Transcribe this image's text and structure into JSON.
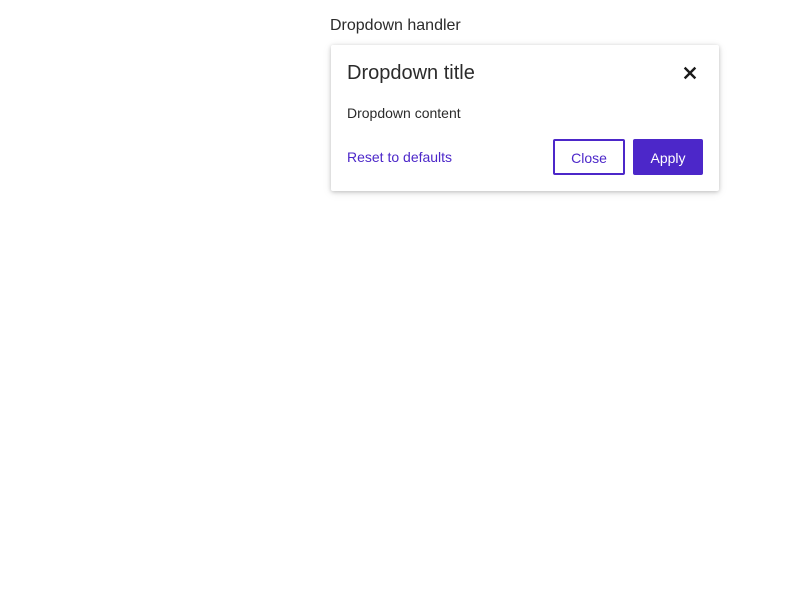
{
  "handler": {
    "label": "Dropdown handler"
  },
  "dropdown": {
    "title": "Dropdown title",
    "close_icon": "close-icon",
    "content": "Dropdown content",
    "reset_label": "Reset to defaults",
    "close_button_label": "Close",
    "apply_button_label": "Apply"
  },
  "colors": {
    "accent": "#4c27c9",
    "text": "#2b2b2b",
    "background": "#ffffff"
  }
}
